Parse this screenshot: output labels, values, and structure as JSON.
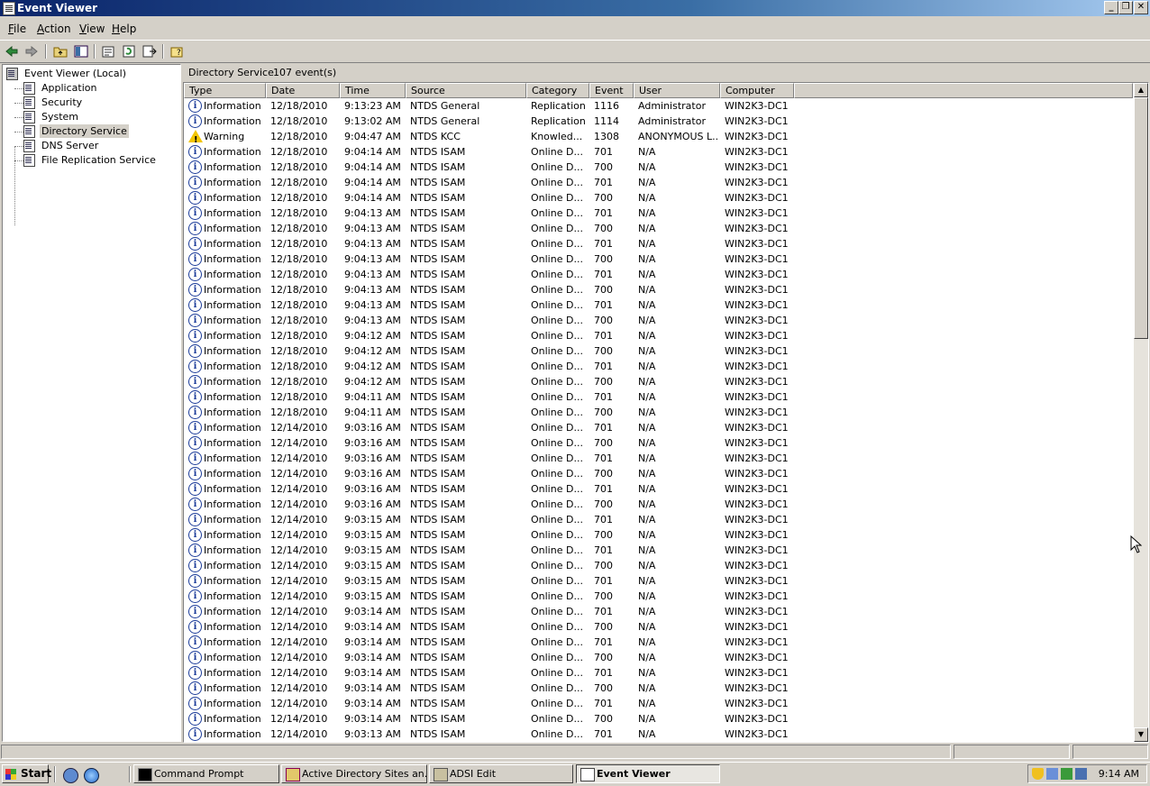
{
  "window": {
    "title": "Event Viewer",
    "minimize": "_",
    "restore": "❐",
    "close": "✕"
  },
  "menu": {
    "file": {
      "ul": "F",
      "rest": "ile"
    },
    "action": {
      "ul": "A",
      "rest": "ction"
    },
    "view": {
      "ul": "V",
      "rest": "iew"
    },
    "help": {
      "ul": "H",
      "rest": "elp"
    }
  },
  "tree": {
    "root": "Event Viewer (Local)",
    "items": [
      {
        "label": "Application",
        "selected": false
      },
      {
        "label": "Security",
        "selected": false
      },
      {
        "label": "System",
        "selected": false
      },
      {
        "label": "Directory Service",
        "selected": true
      },
      {
        "label": "DNS Server",
        "selected": false
      },
      {
        "label": "File Replication Service",
        "selected": false
      }
    ]
  },
  "pane": {
    "log_name": "Directory Service",
    "event_count": "107 event(s)"
  },
  "columns": [
    "Type",
    "Date",
    "Time",
    "Source",
    "Category",
    "Event",
    "User",
    "Computer"
  ],
  "events": [
    {
      "type": "Information",
      "date": "12/18/2010",
      "time": "9:13:23 AM",
      "source": "NTDS General",
      "category": "Replication",
      "event": "1116",
      "user": "Administrator",
      "computer": "WIN2K3-DC1"
    },
    {
      "type": "Information",
      "date": "12/18/2010",
      "time": "9:13:02 AM",
      "source": "NTDS General",
      "category": "Replication",
      "event": "1114",
      "user": "Administrator",
      "computer": "WIN2K3-DC1"
    },
    {
      "type": "Warning",
      "date": "12/18/2010",
      "time": "9:04:47 AM",
      "source": "NTDS KCC",
      "category": "Knowled...",
      "event": "1308",
      "user": "ANONYMOUS L...",
      "computer": "WIN2K3-DC1"
    },
    {
      "type": "Information",
      "date": "12/18/2010",
      "time": "9:04:14 AM",
      "source": "NTDS ISAM",
      "category": "Online D...",
      "event": "701",
      "user": "N/A",
      "computer": "WIN2K3-DC1"
    },
    {
      "type": "Information",
      "date": "12/18/2010",
      "time": "9:04:14 AM",
      "source": "NTDS ISAM",
      "category": "Online D...",
      "event": "700",
      "user": "N/A",
      "computer": "WIN2K3-DC1"
    },
    {
      "type": "Information",
      "date": "12/18/2010",
      "time": "9:04:14 AM",
      "source": "NTDS ISAM",
      "category": "Online D...",
      "event": "701",
      "user": "N/A",
      "computer": "WIN2K3-DC1"
    },
    {
      "type": "Information",
      "date": "12/18/2010",
      "time": "9:04:14 AM",
      "source": "NTDS ISAM",
      "category": "Online D...",
      "event": "700",
      "user": "N/A",
      "computer": "WIN2K3-DC1"
    },
    {
      "type": "Information",
      "date": "12/18/2010",
      "time": "9:04:13 AM",
      "source": "NTDS ISAM",
      "category": "Online D...",
      "event": "701",
      "user": "N/A",
      "computer": "WIN2K3-DC1"
    },
    {
      "type": "Information",
      "date": "12/18/2010",
      "time": "9:04:13 AM",
      "source": "NTDS ISAM",
      "category": "Online D...",
      "event": "700",
      "user": "N/A",
      "computer": "WIN2K3-DC1"
    },
    {
      "type": "Information",
      "date": "12/18/2010",
      "time": "9:04:13 AM",
      "source": "NTDS ISAM",
      "category": "Online D...",
      "event": "701",
      "user": "N/A",
      "computer": "WIN2K3-DC1"
    },
    {
      "type": "Information",
      "date": "12/18/2010",
      "time": "9:04:13 AM",
      "source": "NTDS ISAM",
      "category": "Online D...",
      "event": "700",
      "user": "N/A",
      "computer": "WIN2K3-DC1"
    },
    {
      "type": "Information",
      "date": "12/18/2010",
      "time": "9:04:13 AM",
      "source": "NTDS ISAM",
      "category": "Online D...",
      "event": "701",
      "user": "N/A",
      "computer": "WIN2K3-DC1"
    },
    {
      "type": "Information",
      "date": "12/18/2010",
      "time": "9:04:13 AM",
      "source": "NTDS ISAM",
      "category": "Online D...",
      "event": "700",
      "user": "N/A",
      "computer": "WIN2K3-DC1"
    },
    {
      "type": "Information",
      "date": "12/18/2010",
      "time": "9:04:13 AM",
      "source": "NTDS ISAM",
      "category": "Online D...",
      "event": "701",
      "user": "N/A",
      "computer": "WIN2K3-DC1"
    },
    {
      "type": "Information",
      "date": "12/18/2010",
      "time": "9:04:13 AM",
      "source": "NTDS ISAM",
      "category": "Online D...",
      "event": "700",
      "user": "N/A",
      "computer": "WIN2K3-DC1"
    },
    {
      "type": "Information",
      "date": "12/18/2010",
      "time": "9:04:12 AM",
      "source": "NTDS ISAM",
      "category": "Online D...",
      "event": "701",
      "user": "N/A",
      "computer": "WIN2K3-DC1"
    },
    {
      "type": "Information",
      "date": "12/18/2010",
      "time": "9:04:12 AM",
      "source": "NTDS ISAM",
      "category": "Online D...",
      "event": "700",
      "user": "N/A",
      "computer": "WIN2K3-DC1"
    },
    {
      "type": "Information",
      "date": "12/18/2010",
      "time": "9:04:12 AM",
      "source": "NTDS ISAM",
      "category": "Online D...",
      "event": "701",
      "user": "N/A",
      "computer": "WIN2K3-DC1"
    },
    {
      "type": "Information",
      "date": "12/18/2010",
      "time": "9:04:12 AM",
      "source": "NTDS ISAM",
      "category": "Online D...",
      "event": "700",
      "user": "N/A",
      "computer": "WIN2K3-DC1"
    },
    {
      "type": "Information",
      "date": "12/18/2010",
      "time": "9:04:11 AM",
      "source": "NTDS ISAM",
      "category": "Online D...",
      "event": "701",
      "user": "N/A",
      "computer": "WIN2K3-DC1"
    },
    {
      "type": "Information",
      "date": "12/18/2010",
      "time": "9:04:11 AM",
      "source": "NTDS ISAM",
      "category": "Online D...",
      "event": "700",
      "user": "N/A",
      "computer": "WIN2K3-DC1"
    },
    {
      "type": "Information",
      "date": "12/14/2010",
      "time": "9:03:16 AM",
      "source": "NTDS ISAM",
      "category": "Online D...",
      "event": "701",
      "user": "N/A",
      "computer": "WIN2K3-DC1"
    },
    {
      "type": "Information",
      "date": "12/14/2010",
      "time": "9:03:16 AM",
      "source": "NTDS ISAM",
      "category": "Online D...",
      "event": "700",
      "user": "N/A",
      "computer": "WIN2K3-DC1"
    },
    {
      "type": "Information",
      "date": "12/14/2010",
      "time": "9:03:16 AM",
      "source": "NTDS ISAM",
      "category": "Online D...",
      "event": "701",
      "user": "N/A",
      "computer": "WIN2K3-DC1"
    },
    {
      "type": "Information",
      "date": "12/14/2010",
      "time": "9:03:16 AM",
      "source": "NTDS ISAM",
      "category": "Online D...",
      "event": "700",
      "user": "N/A",
      "computer": "WIN2K3-DC1"
    },
    {
      "type": "Information",
      "date": "12/14/2010",
      "time": "9:03:16 AM",
      "source": "NTDS ISAM",
      "category": "Online D...",
      "event": "701",
      "user": "N/A",
      "computer": "WIN2K3-DC1"
    },
    {
      "type": "Information",
      "date": "12/14/2010",
      "time": "9:03:16 AM",
      "source": "NTDS ISAM",
      "category": "Online D...",
      "event": "700",
      "user": "N/A",
      "computer": "WIN2K3-DC1"
    },
    {
      "type": "Information",
      "date": "12/14/2010",
      "time": "9:03:15 AM",
      "source": "NTDS ISAM",
      "category": "Online D...",
      "event": "701",
      "user": "N/A",
      "computer": "WIN2K3-DC1"
    },
    {
      "type": "Information",
      "date": "12/14/2010",
      "time": "9:03:15 AM",
      "source": "NTDS ISAM",
      "category": "Online D...",
      "event": "700",
      "user": "N/A",
      "computer": "WIN2K3-DC1"
    },
    {
      "type": "Information",
      "date": "12/14/2010",
      "time": "9:03:15 AM",
      "source": "NTDS ISAM",
      "category": "Online D...",
      "event": "701",
      "user": "N/A",
      "computer": "WIN2K3-DC1"
    },
    {
      "type": "Information",
      "date": "12/14/2010",
      "time": "9:03:15 AM",
      "source": "NTDS ISAM",
      "category": "Online D...",
      "event": "700",
      "user": "N/A",
      "computer": "WIN2K3-DC1"
    },
    {
      "type": "Information",
      "date": "12/14/2010",
      "time": "9:03:15 AM",
      "source": "NTDS ISAM",
      "category": "Online D...",
      "event": "701",
      "user": "N/A",
      "computer": "WIN2K3-DC1"
    },
    {
      "type": "Information",
      "date": "12/14/2010",
      "time": "9:03:15 AM",
      "source": "NTDS ISAM",
      "category": "Online D...",
      "event": "700",
      "user": "N/A",
      "computer": "WIN2K3-DC1"
    },
    {
      "type": "Information",
      "date": "12/14/2010",
      "time": "9:03:14 AM",
      "source": "NTDS ISAM",
      "category": "Online D...",
      "event": "701",
      "user": "N/A",
      "computer": "WIN2K3-DC1"
    },
    {
      "type": "Information",
      "date": "12/14/2010",
      "time": "9:03:14 AM",
      "source": "NTDS ISAM",
      "category": "Online D...",
      "event": "700",
      "user": "N/A",
      "computer": "WIN2K3-DC1"
    },
    {
      "type": "Information",
      "date": "12/14/2010",
      "time": "9:03:14 AM",
      "source": "NTDS ISAM",
      "category": "Online D...",
      "event": "701",
      "user": "N/A",
      "computer": "WIN2K3-DC1"
    },
    {
      "type": "Information",
      "date": "12/14/2010",
      "time": "9:03:14 AM",
      "source": "NTDS ISAM",
      "category": "Online D...",
      "event": "700",
      "user": "N/A",
      "computer": "WIN2K3-DC1"
    },
    {
      "type": "Information",
      "date": "12/14/2010",
      "time": "9:03:14 AM",
      "source": "NTDS ISAM",
      "category": "Online D...",
      "event": "701",
      "user": "N/A",
      "computer": "WIN2K3-DC1"
    },
    {
      "type": "Information",
      "date": "12/14/2010",
      "time": "9:03:14 AM",
      "source": "NTDS ISAM",
      "category": "Online D...",
      "event": "700",
      "user": "N/A",
      "computer": "WIN2K3-DC1"
    },
    {
      "type": "Information",
      "date": "12/14/2010",
      "time": "9:03:14 AM",
      "source": "NTDS ISAM",
      "category": "Online D...",
      "event": "701",
      "user": "N/A",
      "computer": "WIN2K3-DC1"
    },
    {
      "type": "Information",
      "date": "12/14/2010",
      "time": "9:03:14 AM",
      "source": "NTDS ISAM",
      "category": "Online D...",
      "event": "700",
      "user": "N/A",
      "computer": "WIN2K3-DC1"
    },
    {
      "type": "Information",
      "date": "12/14/2010",
      "time": "9:03:13 AM",
      "source": "NTDS ISAM",
      "category": "Online D...",
      "event": "701",
      "user": "N/A",
      "computer": "WIN2K3-DC1"
    }
  ],
  "taskbar": {
    "start_label": "Start",
    "tasks": [
      {
        "label": "Command Prompt",
        "active": false
      },
      {
        "label": "Active Directory Sites an...",
        "active": false
      },
      {
        "label": "ADSI Edit",
        "active": false
      },
      {
        "label": "Event Viewer",
        "active": true
      }
    ],
    "clock": "9:14 AM"
  },
  "colors": {
    "title_gradient_start": "#0a246a",
    "title_gradient_end": "#a6caf0",
    "info_icon": "#1d3d9a",
    "warning_icon": "#f2c500"
  }
}
